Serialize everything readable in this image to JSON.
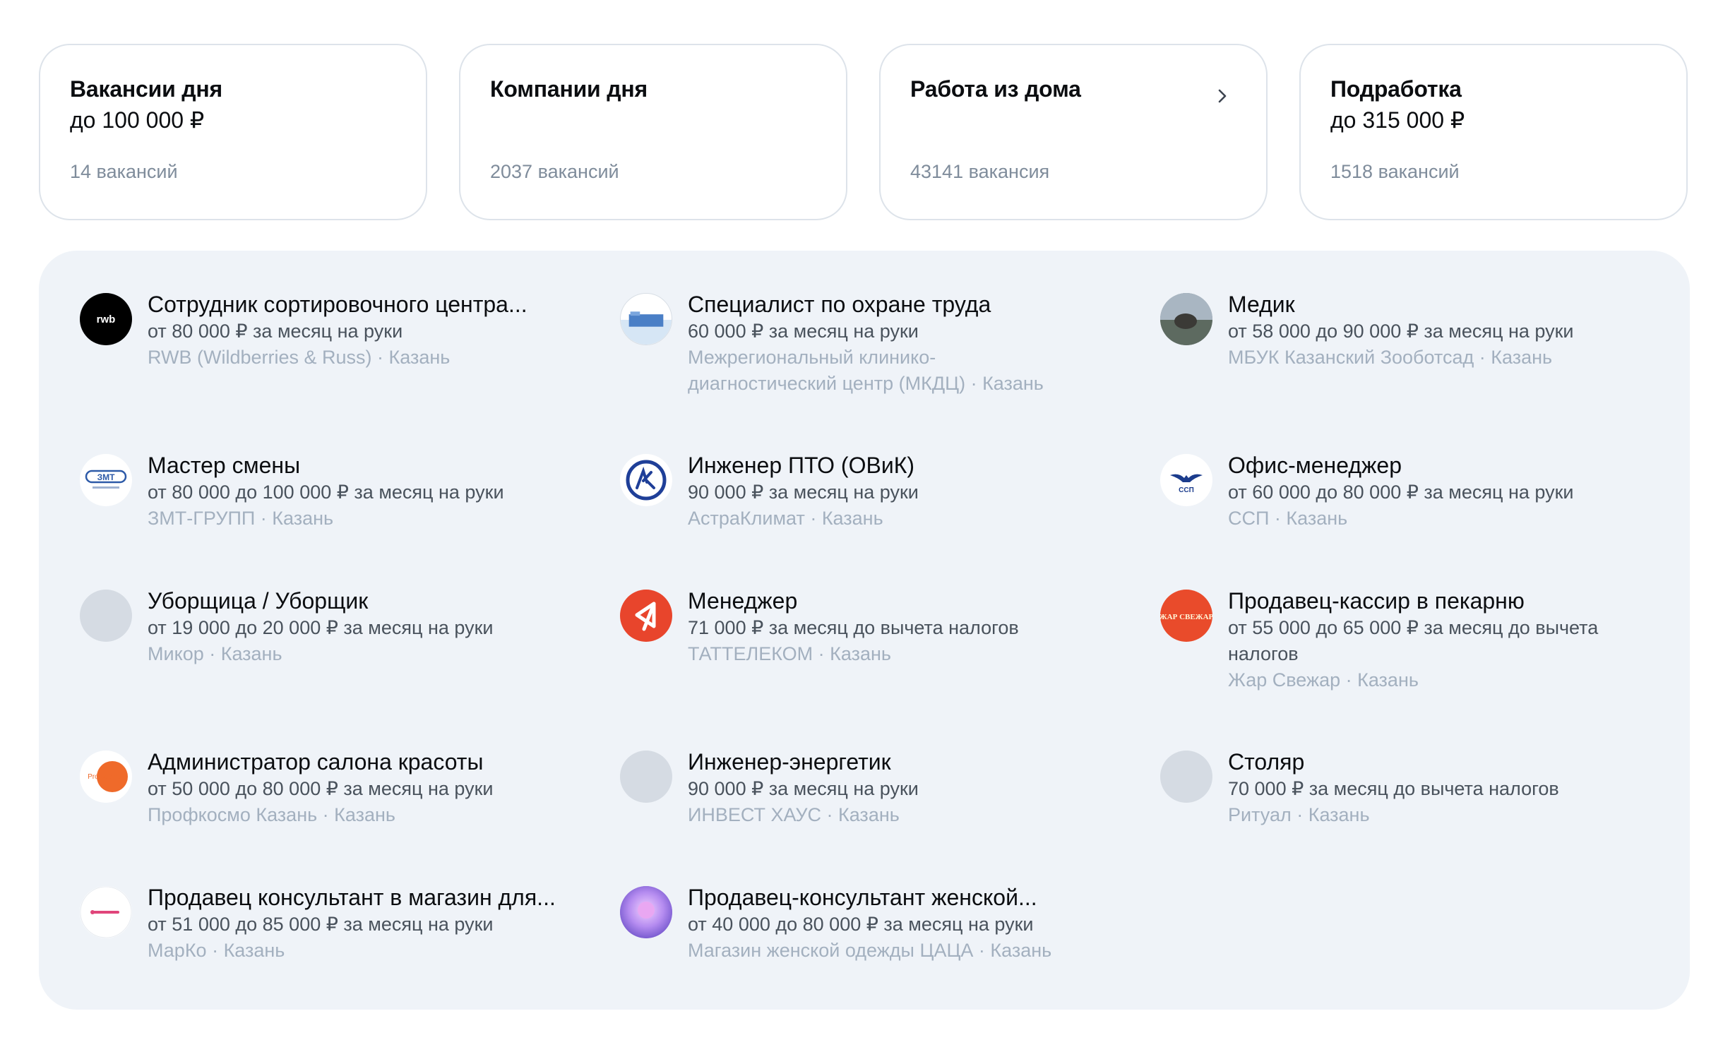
{
  "cards": [
    {
      "title": "Вакансии дня",
      "subtitle": "до 100 000 ₽",
      "count": "14 вакансий"
    },
    {
      "title": "Компании дня",
      "subtitle": "",
      "count": "2037 вакансий"
    },
    {
      "title": "Работа из дома",
      "subtitle": "",
      "count": "43141 вакансия",
      "icon": "chevron-right-icon"
    },
    {
      "title": "Подработка",
      "subtitle": "до 315 000 ₽",
      "count": "1518 вакансий"
    }
  ],
  "vacancies": [
    {
      "title": "Сотрудник сортировочного центра...",
      "salary": "от 80 000 ₽ за месяц на руки",
      "company": "RWB (Wildberries & Russ) · Казань",
      "logo": "rwb-logo"
    },
    {
      "title": "Специалист по охране труда",
      "salary": "60 000 ₽ за месяц на руки",
      "company": "Межрегиональный клинико-диагностический центр (МКДЦ) · Казань",
      "logo": "mkdc-logo"
    },
    {
      "title": "Медик",
      "salary": "от 58 000 до 90 000 ₽ за месяц на руки",
      "company": "МБУК Казанский Зооботсад · Казань",
      "logo": "zoo-logo"
    },
    {
      "title": "Мастер смены",
      "salary": "от 80 000 до 100 000 ₽ за месяц на руки",
      "company": "ЗМТ-ГРУПП · Казань",
      "logo": "zmt-logo",
      "logo_text": "ЗМТ"
    },
    {
      "title": "Инженер ПТО (ОВиК)",
      "salary": "90 000 ₽ за месяц на руки",
      "company": "АстраКлимат · Казань",
      "logo": "astraklimat-logo"
    },
    {
      "title": "Офис-менеджер",
      "salary": "от 60 000 до 80 000 ₽ за месяц на руки",
      "company": "ССП · Казань",
      "logo": "ssp-logo",
      "logo_text": "ССП"
    },
    {
      "title": "Уборщица / Уборщик",
      "salary": "от 19 000 до 20 000 ₽ за месяц на руки",
      "company": "Микор · Казань",
      "logo": "placeholder-logo"
    },
    {
      "title": "Менеджер",
      "salary": "71 000 ₽ за месяц до вычета налогов",
      "company": "ТАТТЕЛЕКОМ · Казань",
      "logo": "tattelecom-logo"
    },
    {
      "title": "Продавец-кассир в пекарню",
      "salary": "от 55 000 до 65 000 ₽ за месяц до вычета налогов",
      "company": "Жар Свежар · Казань",
      "logo": "zhar-svezhar-logo",
      "logo_text": "ЖАР СВЕЖАР"
    },
    {
      "title": "Администратор салона красоты",
      "salary": "от 50 000 до 80 000 ₽ за месяц на руки",
      "company": "Профкосмо Казань · Казань",
      "logo": "profcosmo-logo",
      "logo_text": "Profcosmo"
    },
    {
      "title": "Инженер-энергетик",
      "salary": "90 000 ₽ за месяц на руки",
      "company": "ИНВЕСТ ХАУС · Казань",
      "logo": "placeholder-logo"
    },
    {
      "title": "Столяр",
      "salary": "70 000 ₽ за месяц до вычета налогов",
      "company": "Ритуал · Казань",
      "logo": "placeholder-logo"
    },
    {
      "title": "Продавец консультант в магазин для...",
      "salary": "от 51 000 до 85 000 ₽ за месяц на руки",
      "company": "МарКо · Казань",
      "logo": "marko-logo"
    },
    {
      "title": "Продавец-консультант женской...",
      "salary": "от 40 000 до 80 000 ₽ за месяц на руки",
      "company": "Магазин женской одежды ЦАЦА · Казань",
      "logo": "tsatsa-logo"
    }
  ],
  "colors": {
    "accent_tattelecom": "#e8452c",
    "accent_profcosmo": "#e8642c",
    "panel_bg": "#eff3f8",
    "muted_text": "#a3b0bf"
  }
}
